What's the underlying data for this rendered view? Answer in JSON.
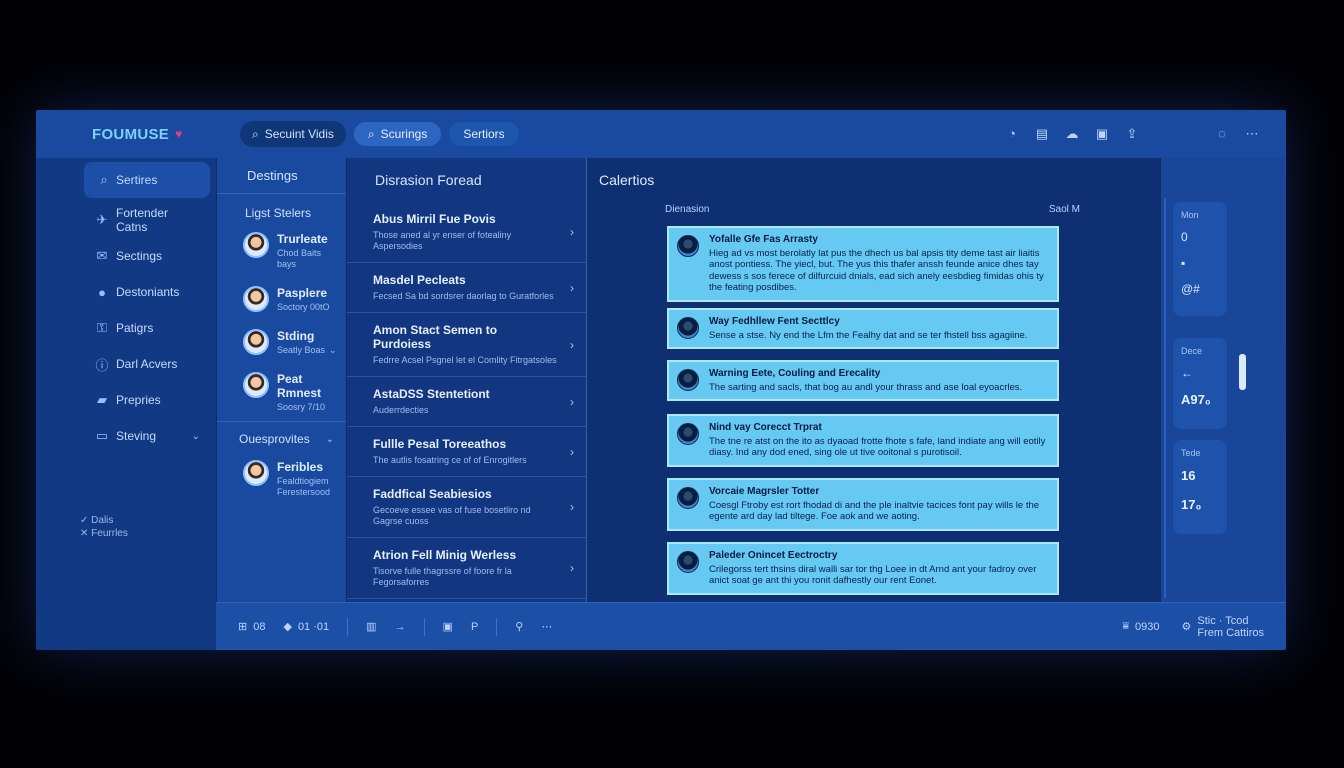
{
  "app": {
    "brand": "FOUMUSE",
    "brand_icon": "heart-icon"
  },
  "topbar": {
    "search_text": "Secuint Vidis",
    "pill_1": "Scurings",
    "pill_2": "Sertiors",
    "icons": [
      "timer-icon",
      "document-icon",
      "cloud-icon",
      "bag-icon",
      "share-icon",
      "chat-icon",
      "more-icon"
    ]
  },
  "leftnav": {
    "items": [
      {
        "label": "Sertires",
        "icon": "search-icon"
      },
      {
        "label": "Fortender Catns",
        "icon": "bird-icon"
      },
      {
        "label": "Sectings",
        "icon": "mail-icon"
      },
      {
        "label": "Destoniants",
        "icon": "circle-icon"
      },
      {
        "label": "Patigrs",
        "icon": "key-icon"
      },
      {
        "label": "Darl Acvers",
        "icon": "info-icon"
      },
      {
        "label": "Prepries",
        "icon": "folder-icon"
      },
      {
        "label": "Steving",
        "icon": "monitor-icon"
      }
    ],
    "footer": [
      "Dalis",
      "Feurrles"
    ]
  },
  "contacts": {
    "header": "Destings",
    "subheader": "Ligst Stelers",
    "items": [
      {
        "name": "Trurleate",
        "sub": "Chod Baits bays"
      },
      {
        "name": "Pasplere",
        "sub": "Soctory 00tO"
      },
      {
        "name": "Stding",
        "sub": "Seatly Boas"
      },
      {
        "name": "Peat Rmnest",
        "sub": "Soosry 7/10"
      }
    ],
    "section": "Ouesprovites",
    "extra": {
      "name": "Feribles",
      "sub": "Fealdtiogiem Ferestersood"
    }
  },
  "threads": {
    "header": "Disrasion Foread",
    "items": [
      {
        "title": "Abus Mirril Fue Povis",
        "sub": "Those aned al yr enser of fotealiny Aspersodies"
      },
      {
        "title": "Masdel Pecleats",
        "sub": "Fecsed Sa bd sordsrer daorlag to Guratforles"
      },
      {
        "title": "Amon Stact Semen to Purdoiess",
        "sub": "Fedrre Acsel Psgnel let el Comlity Fitrgatsoles"
      },
      {
        "title": "AstaDSS Stentetiont",
        "sub": "Auderrdecties"
      },
      {
        "title": "Fullle Pesal Toreeathos",
        "sub": "The autlis fosatring ce of of Enrogitlers"
      },
      {
        "title": "Faddfical Seabiesios",
        "sub": "Gecoeve essee vas of fuse bosetliro nd Gagrse cuoss"
      },
      {
        "title": "Atrion Fell Minig Werless",
        "sub": "Tisorve fulle thagrssre of foore fr la Fegorsaforres"
      }
    ]
  },
  "main": {
    "header": "Calertios",
    "meta_left": "Dienasion",
    "meta_right": "Saol M",
    "messages": [
      {
        "title": "Yofalle Gfe Fas Arrasty",
        "body": "Hieg ad vs most berolatly lat pus the dhech us bal apsis tity deme tast air liaitis anost pontiess. The yiecl, but. The yus this thafer anssh feunde anice dhes tay dewess s sos ferece of dilfurcuid dnials, ead sich anely eesbdieg fimidas ohis ty the feating posdibes."
      },
      {
        "title": "Way Fedhllew Fent Secttlcy",
        "body": "Sense a stse. Ny end the Lfm the Fealhy dat and se ter fhstell bss agagiine."
      },
      {
        "title": "Warning Eete, Couling and Erecality",
        "body": "The sarting and sacls, that bog au andl your thrass and ase loal eyoacrles."
      },
      {
        "title": "Nind vay Corecct Trprat",
        "body": "The tne re atst on the ito as dyaoad frotte fhote s fafe, land indiate ang will eotily diasy. Ind any dod ened, sing ole ut tive ooitonal s purotisoil."
      },
      {
        "title": "Vorcaie Magrsler Totter",
        "body": "Coesgl Ftroby est rort fhodad di and the ple inaltvie tacices font pay wills le the egente ard day lad tiltege. Foe aok and we aoting."
      },
      {
        "title": "Paleder Onincet Eectroctry",
        "body": "Crilegorss tert thsins diral walli sar tor thg Loee in dt Arnd ant your fadroy over anict soat ge ant thi you ronit dafhestly our rent Eonet."
      }
    ]
  },
  "rightrail": {
    "card1": {
      "label": "Mon",
      "values": [
        "0",
        "▪",
        "@#"
      ]
    },
    "card2": {
      "label": "Dece",
      "arrow": "←",
      "value": "A97₀"
    },
    "card3": {
      "label": "Tede",
      "value1": "16",
      "value2": "17₀"
    }
  },
  "bottombar": {
    "items": [
      "08",
      "01 ·01",
      "",
      "",
      ""
    ],
    "status_value": "0930",
    "status_label_1": "Stic · Tcod",
    "status_label_2": "Frem Cattiros"
  },
  "colors": {
    "accent": "#66c9f2",
    "background": "#153d88",
    "brand": "#7fd0ff"
  }
}
